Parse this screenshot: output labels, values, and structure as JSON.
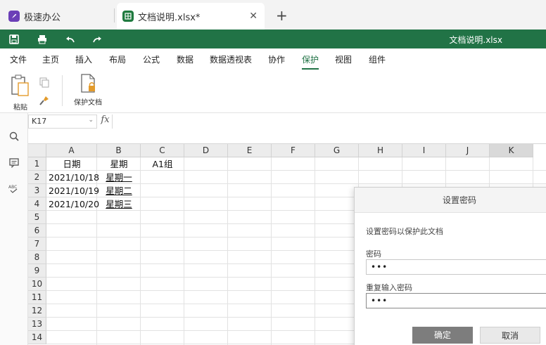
{
  "tabs": [
    {
      "label": "极速办公"
    },
    {
      "label": "文档说明.xlsx*"
    }
  ],
  "quickbar": {
    "title": "文档说明.xlsx"
  },
  "menu": [
    "文件",
    "主页",
    "插入",
    "布局",
    "公式",
    "数据",
    "数据透视表",
    "协作",
    "保护",
    "视图",
    "组件"
  ],
  "menu_active": "保护",
  "ribbon": {
    "paste_label": "粘贴",
    "protect_label": "保护文档"
  },
  "formula_bar": {
    "cell_ref": "K17",
    "fx": "fx",
    "content": ""
  },
  "columns": [
    "A",
    "B",
    "C",
    "D",
    "E",
    "F",
    "G",
    "H",
    "I",
    "J",
    "K"
  ],
  "selected_column": "K",
  "rows": [
    "1",
    "2",
    "3",
    "4",
    "5",
    "6",
    "7",
    "8",
    "9",
    "10",
    "11",
    "12",
    "13",
    "14"
  ],
  "cells": {
    "A1": "日期",
    "B1": "星期",
    "C1": "A1组",
    "A2": "2021/10/18",
    "B2": "星期一",
    "A3": "2021/10/19",
    "B3": "星期二",
    "A4": "2021/10/20",
    "B4": "星期三"
  },
  "dialog": {
    "title": "设置密码",
    "description": "设置密码以保护此文档",
    "password_label": "密码",
    "password_value": "•••",
    "repeat_label": "重复输入密码",
    "repeat_value": "•••",
    "ok": "确定",
    "cancel": "取消"
  },
  "colors": {
    "brand_green": "#217346",
    "active_tab_badge": "#1f7a3f",
    "home_badge": "#6b3fb7"
  },
  "icons": [
    "rocket-icon",
    "sheet-icon",
    "close-icon",
    "plus-icon",
    "save-icon",
    "print-icon",
    "undo-icon",
    "redo-icon",
    "paste-icon",
    "copy-icon",
    "format-painter-icon",
    "protect-doc-icon",
    "search-icon",
    "comment-icon",
    "spellcheck-icon"
  ]
}
